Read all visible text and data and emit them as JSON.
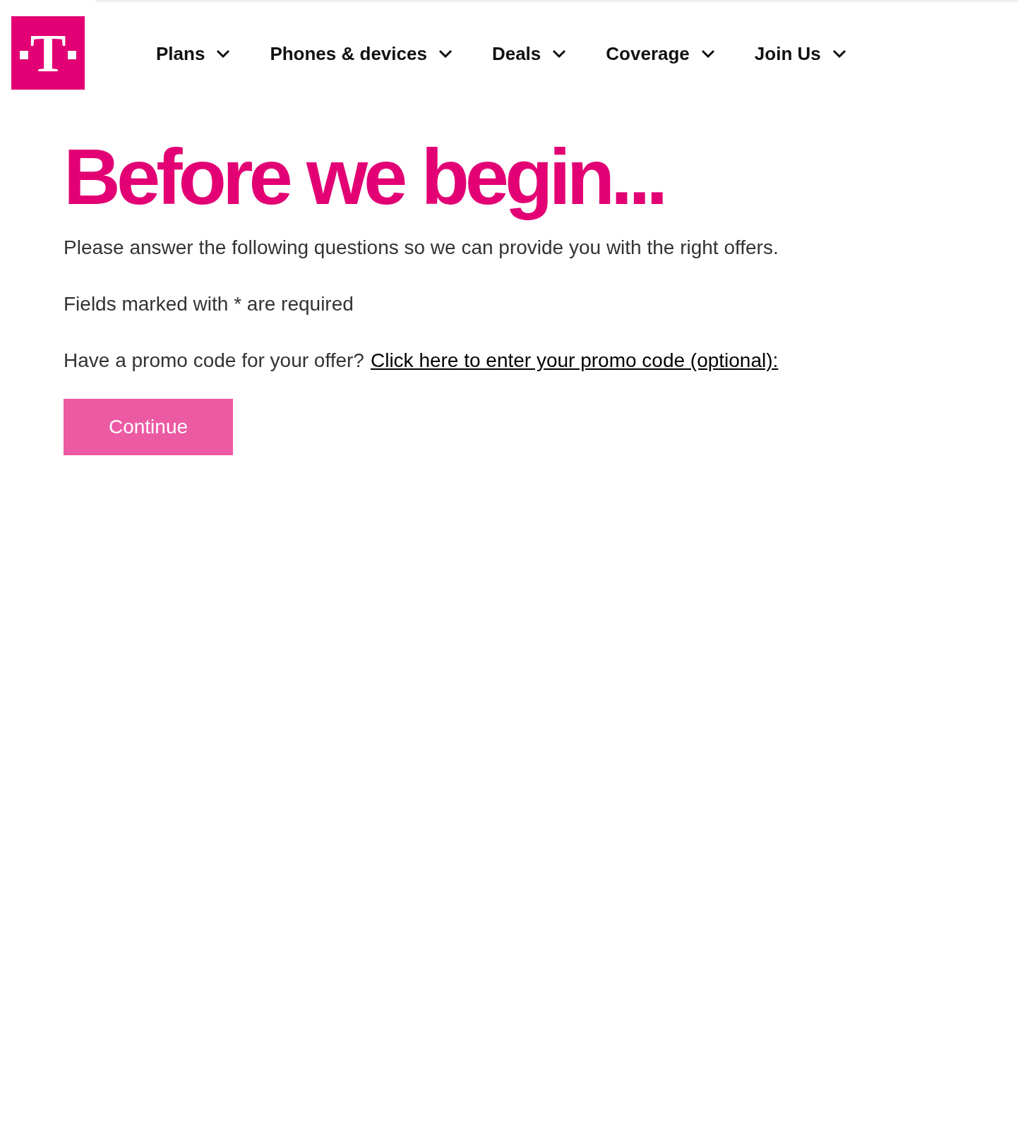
{
  "logo": {
    "letter": "T"
  },
  "nav": [
    {
      "label": "Plans"
    },
    {
      "label": "Phones & devices"
    },
    {
      "label": "Deals"
    },
    {
      "label": "Coverage"
    },
    {
      "label": "Join Us"
    }
  ],
  "heading": "Before we begin...",
  "intro": "Please answer the following questions so we can provide you with the right offers.",
  "required_note": "Fields marked with * are required",
  "promo": {
    "question": "Have a promo code for your offer?",
    "link": "Click here to enter your promo code (optional):"
  },
  "continue_button": "Continue"
}
